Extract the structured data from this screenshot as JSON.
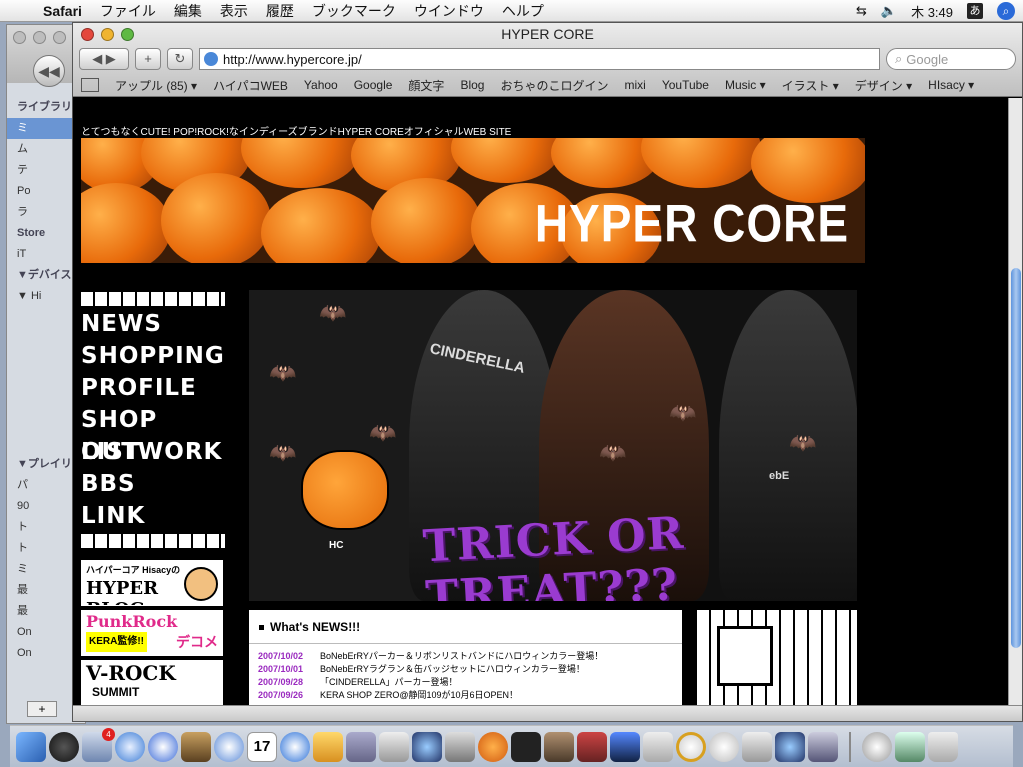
{
  "menubar": {
    "app": "Safari",
    "items": [
      "ファイル",
      "編集",
      "表示",
      "履歴",
      "ブックマーク",
      "ウインドウ",
      "ヘルプ"
    ],
    "clock": "木 3:49",
    "ime": "あ"
  },
  "itunes": {
    "sources": [
      {
        "label": "ライブラリ",
        "type": "header"
      },
      {
        "label": "ミ",
        "type": "selected"
      },
      {
        "label": "ム",
        "type": "item"
      },
      {
        "label": "テ",
        "type": "item"
      },
      {
        "label": "Po",
        "type": "item"
      },
      {
        "label": "ラ",
        "type": "item"
      },
      {
        "label": "Store",
        "type": "header"
      },
      {
        "label": "iT",
        "type": "item"
      },
      {
        "label": "▼デバイス",
        "type": "header"
      },
      {
        "label": "▼ Hi",
        "type": "item"
      },
      {
        "label": "",
        "type": "item"
      },
      {
        "label": "",
        "type": "item"
      },
      {
        "label": "",
        "type": "item"
      },
      {
        "label": "",
        "type": "item"
      },
      {
        "label": "",
        "type": "item"
      },
      {
        "label": "",
        "type": "item"
      },
      {
        "label": "",
        "type": "item"
      },
      {
        "label": "▼プレイリ",
        "type": "header"
      },
      {
        "label": "パ",
        "type": "item"
      },
      {
        "label": "90",
        "type": "item"
      },
      {
        "label": "ト",
        "type": "item"
      },
      {
        "label": "ト",
        "type": "item"
      },
      {
        "label": "ミ",
        "type": "item"
      },
      {
        "label": "最",
        "type": "item"
      },
      {
        "label": "最",
        "type": "item"
      },
      {
        "label": "On",
        "type": "item"
      },
      {
        "label": "On",
        "type": "item"
      }
    ]
  },
  "safari": {
    "window_title": "HYPER CORE",
    "url": "http://www.hypercore.jp/",
    "search_placeholder": "Google",
    "bookmarks": [
      "アップル (85) ▾",
      "ハイパコWEB",
      "Yahoo",
      "Google",
      "顔文字",
      "Blog",
      "おちゃのこログイン",
      "mixi",
      "YouTube",
      "Music ▾",
      "イラスト ▾",
      "デザイン ▾",
      "HIsacy ▾"
    ]
  },
  "site": {
    "tagline": "とてつもなくCUTE! POP!ROCK!なインディーズブランドHYPER COREオフィシャルWEB SITE",
    "brand": "HYPER CORE",
    "nav": [
      "NEWS",
      "SHOPPING",
      "PROFILE",
      "SHOP LIST",
      "OUTWORK",
      "BBS",
      "LINK"
    ],
    "ads": [
      {
        "top": "ハイパーコア Hisacyの",
        "main": "HYPER BLOG"
      },
      {
        "top": "PunkRock",
        "main": "KERA監修!!",
        "extra": "デコメ"
      },
      {
        "top": "V-ROCK",
        "main": "SUMMIT"
      }
    ],
    "hero": {
      "headline": "TRICK OR TREAT???",
      "shirt": "CINDERELLA",
      "tag": "HC",
      "tag2": "ebE"
    },
    "news": {
      "title": "What's NEWS!!!",
      "items": [
        {
          "date": "2007/10/02",
          "text": "BoNebErRYパーカー＆リボンリストバンドにハロウィンカラー登場！"
        },
        {
          "date": "2007/10/01",
          "text": "BoNebErRYラグラン＆缶バッジセットにハロウィンカラー登場！"
        },
        {
          "date": "2007/09/28",
          "text": "「CINDERELLA」パーカー登場！"
        },
        {
          "date": "2007/09/26",
          "text": "KERA SHOP ZERO@静岡109が10月6日OPEN！"
        }
      ]
    }
  },
  "dock": {
    "mail_badge": "4",
    "ical_day": "17",
    "items": [
      "finder",
      "dashboard",
      "mail",
      "safari",
      "itunes-dvd",
      "iphoto",
      "itunes",
      "ical",
      "quicktime",
      "preview",
      "stamps",
      "dvd",
      "ichat",
      "search",
      "flower",
      "eye",
      "mona",
      "photo",
      "film",
      "x",
      "cd",
      "cd2",
      "script",
      "ichat2",
      "app",
      "trash-area",
      "mailfolder",
      "gls",
      "trash"
    ]
  }
}
